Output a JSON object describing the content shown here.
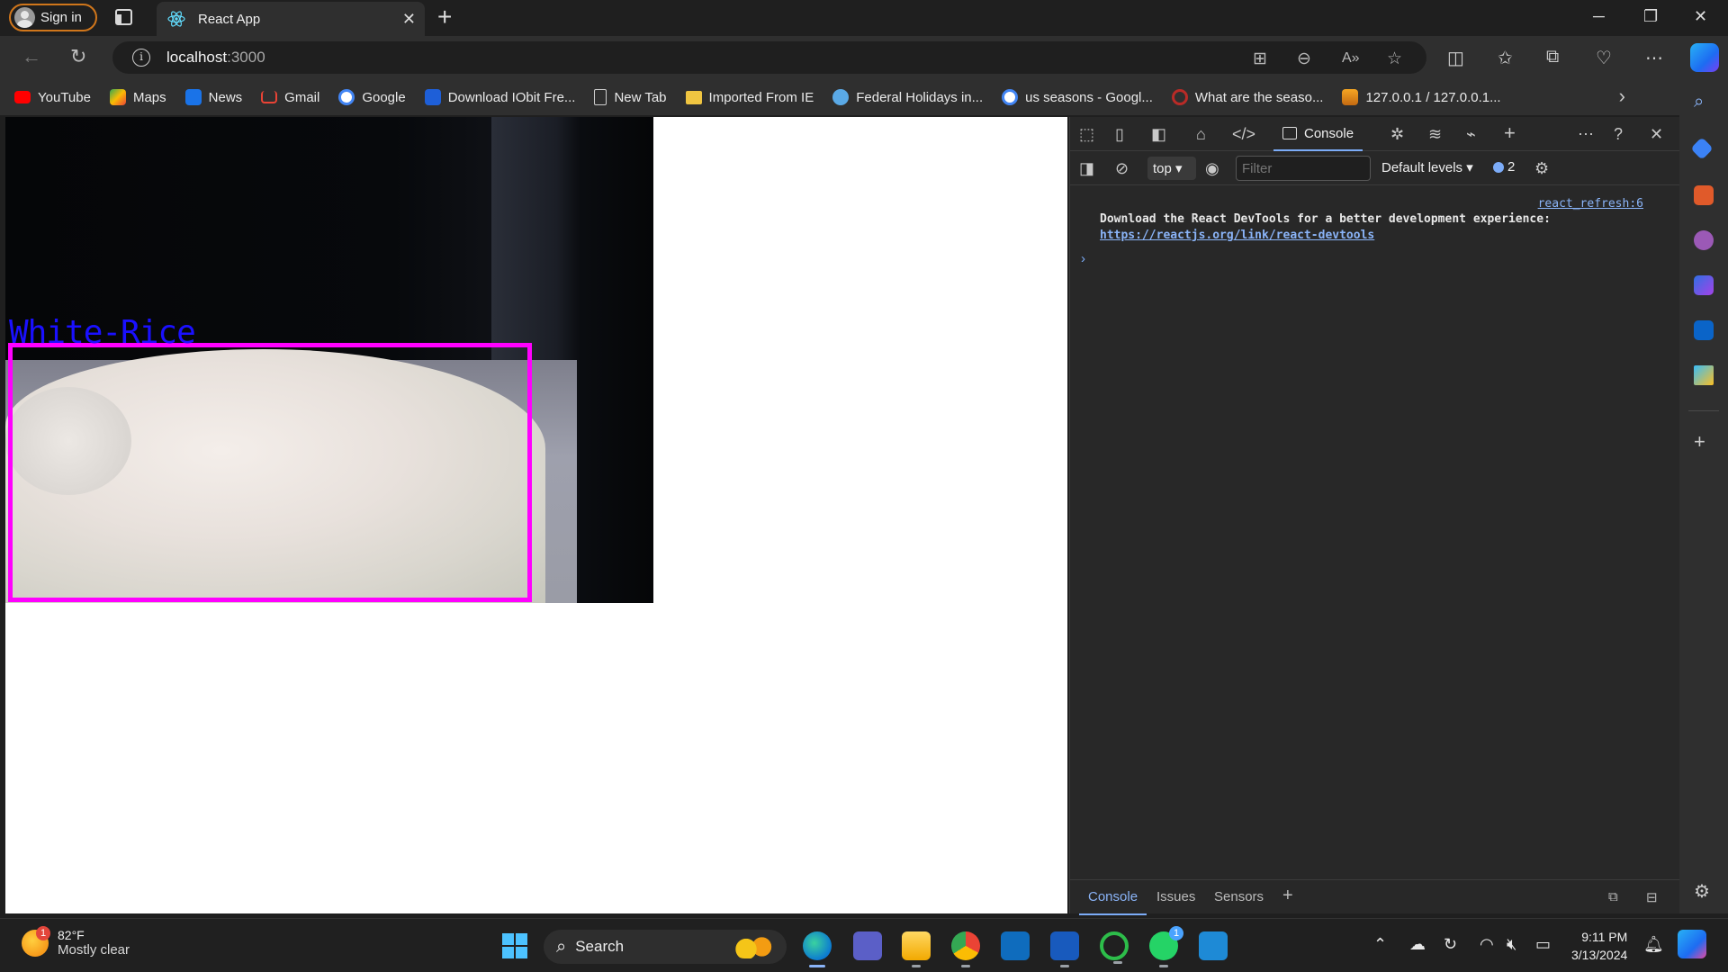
{
  "browser": {
    "sign_in": "Sign in",
    "tab_title": "React App",
    "url_host": "localhost",
    "url_port": ":3000"
  },
  "bookmarks": [
    {
      "label": "YouTube",
      "icon": "youtube-icon",
      "color": "#ff0000"
    },
    {
      "label": "Maps",
      "icon": "maps-icon",
      "color": "#34a853"
    },
    {
      "label": "News",
      "icon": "news-icon",
      "color": "#1a73e8"
    },
    {
      "label": "Gmail",
      "icon": "gmail-icon",
      "color": "#ea4335"
    },
    {
      "label": "Google",
      "icon": "google-icon",
      "color": "#4285f4"
    },
    {
      "label": "Download IObit Fre...",
      "icon": "iobit-icon",
      "color": "#1e5fd8"
    },
    {
      "label": "New Tab",
      "icon": "page-icon",
      "color": "#cfcfcf"
    },
    {
      "label": "Imported From IE",
      "icon": "folder-icon",
      "color": "#f0c541"
    },
    {
      "label": "Federal Holidays in...",
      "icon": "calendar-icon",
      "color": "#5aa9e6"
    },
    {
      "label": "us seasons - Googl...",
      "icon": "google-icon",
      "color": "#4285f4"
    },
    {
      "label": "What are the seaso...",
      "icon": "quora-icon",
      "color": "#b92b27"
    },
    {
      "label": "127.0.0.1 / 127.0.0.1...",
      "icon": "phpmyadmin-icon",
      "color": "#f5a623"
    }
  ],
  "detection": {
    "label": "White-Rice",
    "box_color": "#ff00ff",
    "label_color": "#1a10ff"
  },
  "devtools": {
    "console_tab": "Console",
    "context": "top",
    "filter_placeholder": "Filter",
    "levels": "Default levels",
    "issue_count": "2",
    "message_source": "react_refresh:6",
    "message_text": "Download the React DevTools for a better development experience: ",
    "message_link": "https://reactjs.org/link/react-devtools",
    "drawer_tabs": [
      "Console",
      "Issues",
      "Sensors"
    ]
  },
  "taskbar": {
    "temperature": "82°F",
    "weather": "Mostly clear",
    "weather_badge": "1",
    "search": "Search",
    "time": "9:11 PM",
    "date": "3/13/2024",
    "whatsapp_badge": "1"
  }
}
